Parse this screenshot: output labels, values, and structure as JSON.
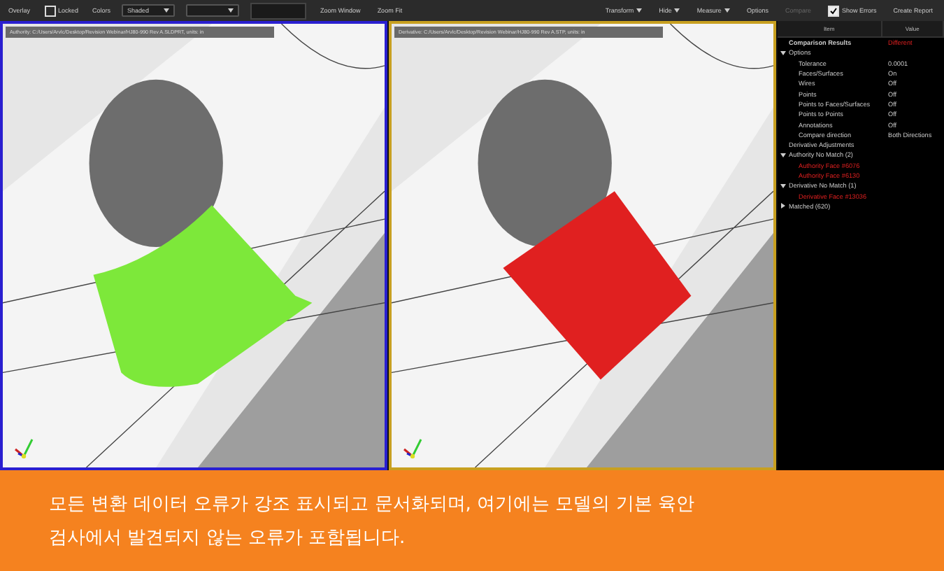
{
  "toolbar": {
    "left": [
      {
        "kind": "label",
        "text": "Overlay"
      },
      {
        "kind": "checkbox",
        "text": "Locked",
        "checked": false
      },
      {
        "kind": "label",
        "text": "Colors"
      },
      {
        "kind": "select",
        "text": "Shaded"
      },
      {
        "kind": "select"
      },
      {
        "kind": "field",
        "disabled": true
      },
      {
        "kind": "button",
        "text": "Zoom Window"
      },
      {
        "kind": "button",
        "text": "Zoom Fit"
      }
    ],
    "right": [
      {
        "kind": "menu",
        "text": "Transform"
      },
      {
        "kind": "menu",
        "text": "Hide"
      },
      {
        "kind": "menu",
        "text": "Measure"
      },
      {
        "kind": "button",
        "text": "Options"
      },
      {
        "kind": "button",
        "text": "Compare",
        "disabled": true
      },
      {
        "kind": "checkbox",
        "text": "Show Errors",
        "checked": true
      },
      {
        "kind": "button",
        "text": "Create Report"
      }
    ]
  },
  "viewports": [
    {
      "kind": "authority",
      "path": "Authority:  C:/Users/Arvlc/Desktop/Revision Webinar/HJ80-990 Rev A.SLDPRT, units: in",
      "color": "#7de83a"
    },
    {
      "kind": "derivative",
      "path": "Derivative:  C:/Users/Arvlc/Desktop/Revision Webinar/HJ80-990 Rev A.STP, units: in",
      "color": "#e02020"
    }
  ],
  "results": {
    "columns": [
      "Item",
      "Value"
    ],
    "tree": [
      {
        "label": "Comparison Results",
        "value": "Different",
        "bold": true,
        "flagged": false
      },
      {
        "label": "Options",
        "flagged": false,
        "expanded": true,
        "children": [
          {
            "label": "Tolerance",
            "value": "0.0001",
            "flagged": false
          },
          {
            "label": "Faces/Surfaces",
            "value": "On",
            "flagged": false
          },
          {
            "label": "Wires",
            "value": "Off",
            "flagged": false
          },
          {
            "label": "Points",
            "value": "Off",
            "flagged": false
          },
          {
            "label": "Points to Faces/Surfaces",
            "value": "Off",
            "flagged": false
          },
          {
            "label": "Points to Points",
            "value": "Off",
            "flagged": false
          },
          {
            "label": "Annotations",
            "value": "Off",
            "flagged": false
          },
          {
            "label": "Compare direction",
            "value": "Both Directions",
            "flagged": false
          }
        ]
      },
      {
        "label": "Derivative Adjustments",
        "flagged": false
      },
      {
        "label": "Authority No Match (2)",
        "flagged": false,
        "expanded": true,
        "children": [
          {
            "label": "Authority Face #6076",
            "flagged": true
          },
          {
            "label": "Authority Face #6130",
            "flagged": true
          }
        ]
      },
      {
        "label": "Derivative No Match (1)",
        "flagged": false,
        "expanded": true,
        "children": [
          {
            "label": "Derivative Face #13036",
            "flagged": true
          }
        ]
      },
      {
        "label": "Matched (620)",
        "flagged": false,
        "expanded": false
      }
    ]
  },
  "caption": [
    "모든 변환 데이터 오류가 강조 표시되고 문서화되며, 여기에는 모델의 기본 육안",
    "검사에서 발견되지 않는 오류가 포함됩니다."
  ]
}
